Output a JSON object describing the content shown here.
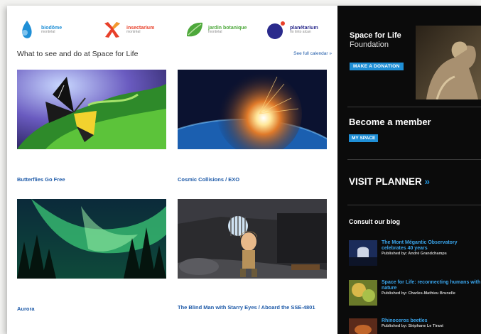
{
  "logos": [
    {
      "name": "biodôme",
      "city": "montréal",
      "color": "#1f8fd6"
    },
    {
      "name": "insectarium",
      "city": "montréal",
      "color": "#e8402a"
    },
    {
      "name": "jardin botanique",
      "city": "montréal",
      "color": "#4da83b"
    },
    {
      "name": "planétarium",
      "city": "rio tinto alcan",
      "color": "#2a2a8c"
    }
  ],
  "section": {
    "title": "What to see and do at Space for Life",
    "calendar_link": "See full calendar »"
  },
  "tiles": [
    {
      "label": "Butterflies Go Free"
    },
    {
      "label": "Cosmic Collisions / EXO"
    },
    {
      "label": "Aurora"
    },
    {
      "label": "The Blind Man with Starry Eyes / Aboard the SSE-4801"
    }
  ],
  "sidebar": {
    "foundation_line1": "Space for Life",
    "foundation_line2": "Foundation",
    "donate_label": "MAKE A DONATION",
    "member_title": "Become a member",
    "myspace_label": "MY SPACE",
    "planner_label": "VISIT PLANNER",
    "planner_chevron": "»",
    "blog_title": "Consult our blog",
    "posts": [
      {
        "title": "The Mont Mégantic Observatory celebrates 40 years",
        "byline": "Published by: André Grandchamps"
      },
      {
        "title": "Space for Life: reconnecting humans with nature",
        "byline": "Published by: Charles-Mathieu Brunelle"
      },
      {
        "title": "Rhinoceros beetles",
        "byline": "Published by: Stéphane Le Tirant"
      }
    ]
  },
  "colors": {
    "link": "#1e5aa8",
    "accent": "#1f8fd6",
    "sidebar_bg": "#0b0b0b"
  }
}
